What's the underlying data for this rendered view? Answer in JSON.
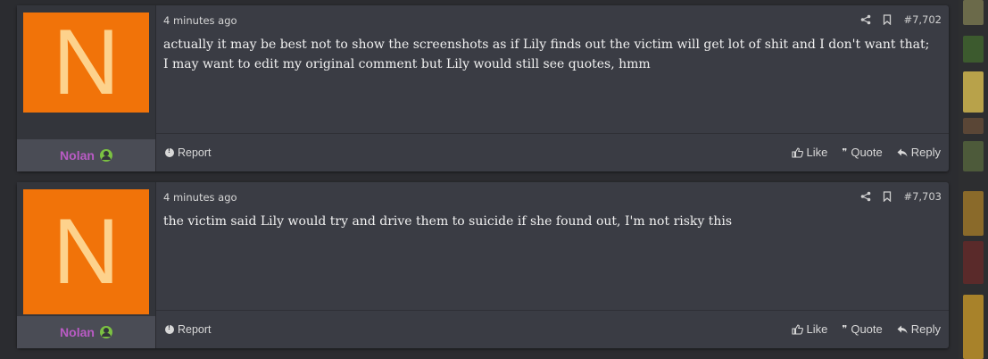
{
  "posts": [
    {
      "avatar_letter": "N",
      "username": "Nolan",
      "timestamp": "4 minutes ago",
      "post_number": "#7,702",
      "body": "actually it may be best not to show the screenshots as if Lily finds out the victim will get lot of shit and I don't want that; I may want to edit my original comment but Lily would still see quotes, hmm",
      "report_label": "Report",
      "like_label": "Like",
      "quote_label": "Quote",
      "reply_label": "Reply"
    },
    {
      "avatar_letter": "N",
      "username": "Nolan",
      "timestamp": "4 minutes ago",
      "post_number": "#7,703",
      "body": "the victim said Lily would try and drive them to suicide if she found out, I'm not risky this",
      "report_label": "Report",
      "like_label": "Like",
      "quote_label": "Quote",
      "reply_label": "Reply"
    }
  ],
  "icons": {
    "share": "share-icon",
    "bookmark": "bookmark-icon",
    "online": "user-online-icon",
    "report": "exclamation-circle-icon",
    "like": "thumbs-up-icon",
    "quote": "quote-icon",
    "reply": "reply-arrow-icon"
  },
  "colors": {
    "avatar_bg": "#f17309",
    "avatar_letter": "#fdd28c",
    "username": "#b95bc4",
    "online": "#7bc142",
    "post_bg": "#3a3c44",
    "page_bg": "#2b2c30"
  }
}
